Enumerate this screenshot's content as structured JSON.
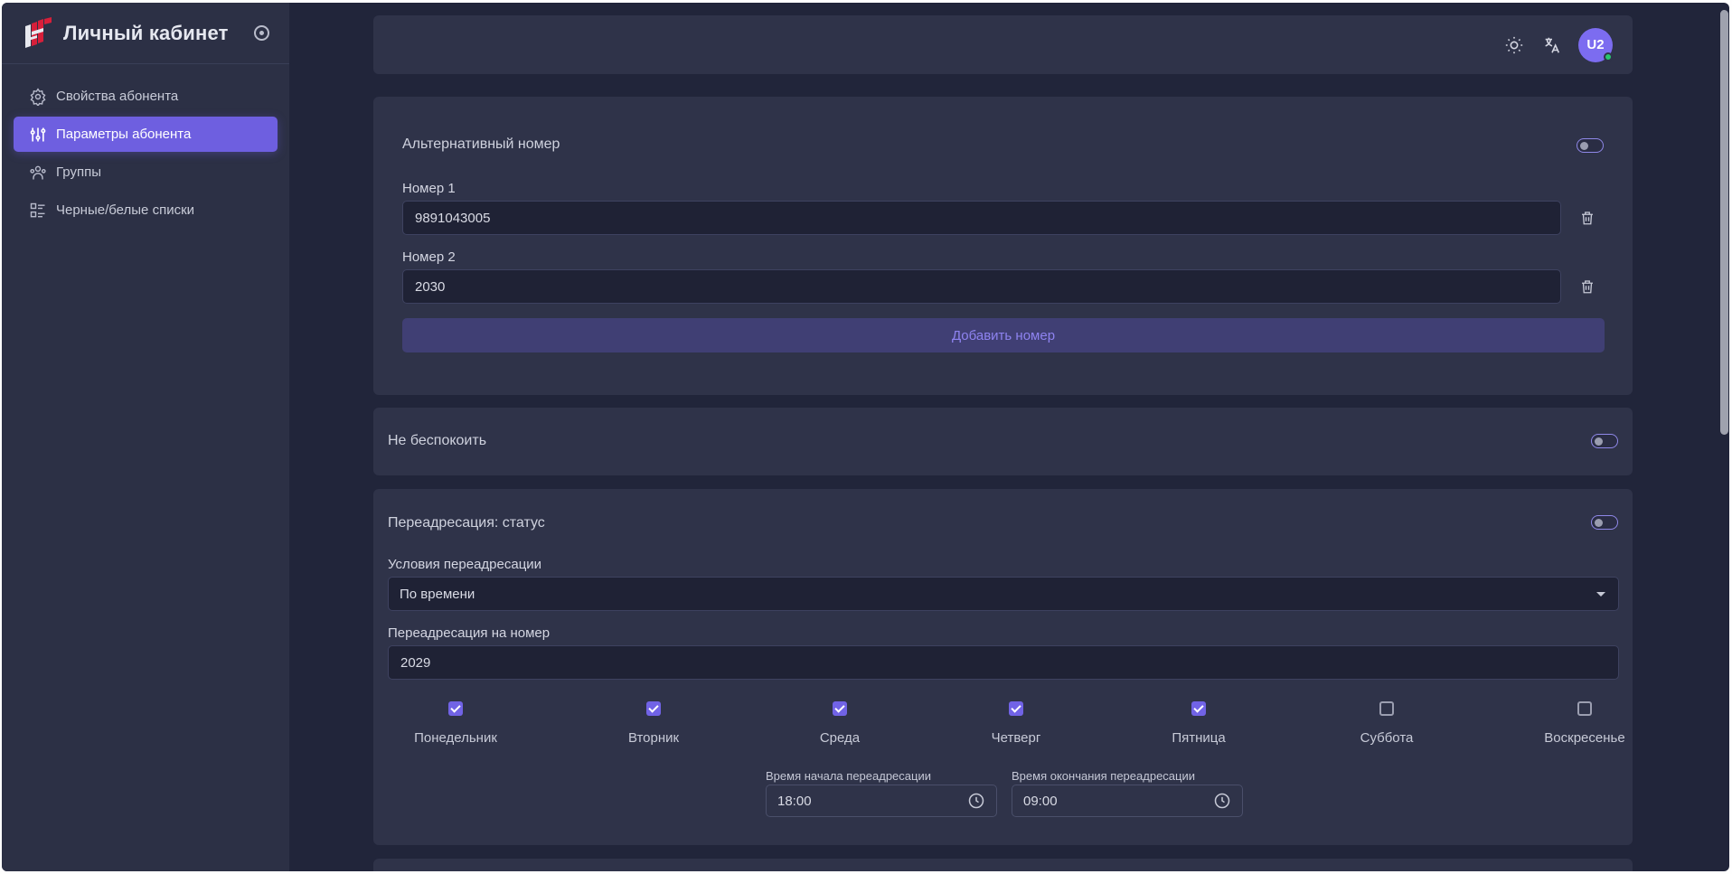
{
  "sidebar": {
    "title": "Личный кабинет",
    "items": [
      {
        "label": "Свойства абонента",
        "icon": "gear-icon"
      },
      {
        "label": "Параметры абонента",
        "icon": "sliders-icon",
        "active": true
      },
      {
        "label": "Группы",
        "icon": "users-icon"
      },
      {
        "label": "Черные/белые списки",
        "icon": "list-icon"
      }
    ]
  },
  "header": {
    "avatar_initials": "U2",
    "icons": [
      "sun-icon",
      "translate-icon"
    ]
  },
  "alt_number": {
    "title": "Альтернативный номер",
    "numbers": [
      {
        "label": "Номер 1",
        "value": "9891043005"
      },
      {
        "label": "Номер 2",
        "value": "2030"
      }
    ],
    "add_button": "Добавить номер"
  },
  "dnd": {
    "title": "Не беспокоить"
  },
  "forwarding": {
    "title": "Переадресация: статус",
    "condition_label": "Условия переадресации",
    "condition_value": "По времени",
    "target_label": "Переадресация на номер",
    "target_value": "2029",
    "days": [
      {
        "label": "Понедельник",
        "checked": true
      },
      {
        "label": "Вторник",
        "checked": true
      },
      {
        "label": "Среда",
        "checked": true
      },
      {
        "label": "Четверг",
        "checked": true
      },
      {
        "label": "Пятница",
        "checked": true
      },
      {
        "label": "Суббота",
        "checked": false
      },
      {
        "label": "Воскресенье",
        "checked": false
      }
    ],
    "start_label": "Время начала переадресации",
    "start_value": "18:00",
    "end_label": "Время окончания переадресации",
    "end_value": "09:00"
  },
  "colors": {
    "accent": "#6e5fe0",
    "background": "#21253a",
    "card": "#2f3349",
    "sidebar": "#2c3045",
    "online": "#28c76f"
  }
}
